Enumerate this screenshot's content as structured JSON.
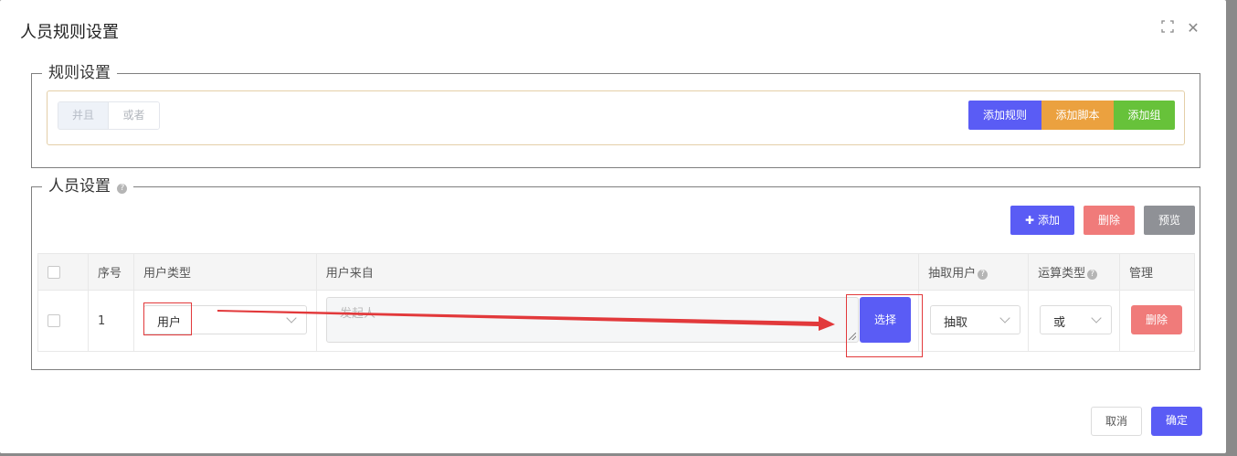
{
  "dialog": {
    "title": "人员规则设置",
    "fullscreen_icon": "fullscreen-icon",
    "close_icon": "close-icon",
    "close_glyph": "✕"
  },
  "rule_settings": {
    "legend": "规则设置",
    "logic_options": [
      "并且",
      "或者"
    ],
    "selected_logic": "并且",
    "add_rule_label": "添加规则",
    "add_script_label": "添加脚本",
    "add_group_label": "添加组"
  },
  "person_settings": {
    "legend": "人员设置",
    "help_glyph": "?",
    "add_label": "添加",
    "add_glyph": "✚",
    "delete_label": "删除",
    "preview_label": "预览"
  },
  "table": {
    "headers": {
      "index": "序号",
      "user_type": "用户类型",
      "user_source": "用户来自",
      "extract_user": "抽取用户",
      "operation_type": "运算类型",
      "manage": "管理"
    },
    "rows": [
      {
        "index": "1",
        "user_type": "用户",
        "user_source_placeholder": "发起人",
        "select_label": "选择",
        "extract_user": "抽取",
        "operation_type": "或",
        "delete_label": "删除"
      }
    ]
  },
  "footer": {
    "cancel_label": "取消",
    "confirm_label": "确定"
  },
  "colors": {
    "primary": "#5a5cf5",
    "warning": "#eba13f",
    "success": "#67c23a",
    "danger": "#f07b7a",
    "info": "#8f9196",
    "annotation": "#e2393b"
  }
}
